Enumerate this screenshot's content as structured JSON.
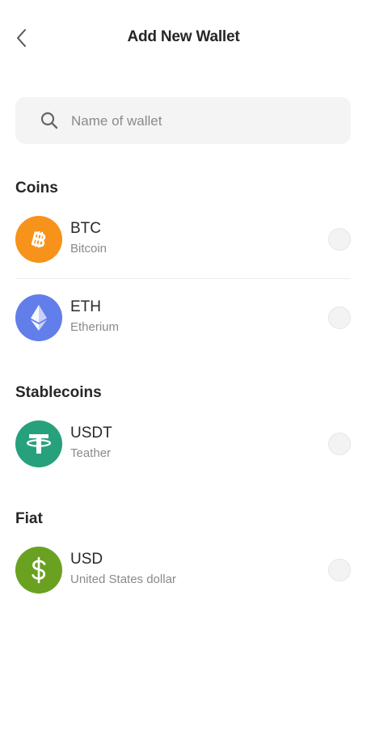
{
  "header": {
    "title": "Add New Wallet",
    "back_icon": "chevron-left-icon"
  },
  "search": {
    "placeholder": "Name of wallet",
    "icon": "search-icon"
  },
  "sections": {
    "coins": {
      "title": "Coins",
      "items": [
        {
          "symbol": "BTC",
          "name": "Bitcoin",
          "color": "#F7931A",
          "icon": "bitcoin-icon",
          "selected": false
        },
        {
          "symbol": "ETH",
          "name": "Etherium",
          "color": "#627EEA",
          "icon": "ethereum-icon",
          "selected": false
        }
      ]
    },
    "stablecoins": {
      "title": "Stablecoins",
      "items": [
        {
          "symbol": "USDT",
          "name": "Teather",
          "color": "#26A17B",
          "icon": "tether-icon",
          "selected": false
        }
      ]
    },
    "fiat": {
      "title": "Fiat",
      "items": [
        {
          "symbol": "USD",
          "name": "United States dollar",
          "color": "#6AA121",
          "icon": "dollar-icon",
          "selected": false
        }
      ]
    }
  }
}
